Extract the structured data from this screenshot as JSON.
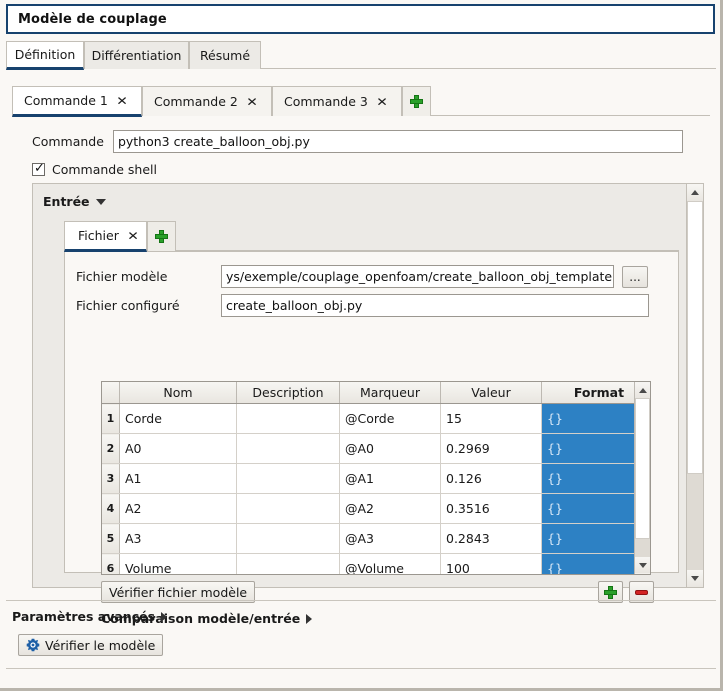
{
  "window": {
    "title": "Modèle de couplage"
  },
  "top_tabs": [
    {
      "label": "Définition",
      "active": true
    },
    {
      "label": "Différentiation",
      "active": false
    },
    {
      "label": "Résumé",
      "active": false
    }
  ],
  "command_tabs": [
    {
      "label": "Commande 1",
      "close_icon": "close-icon",
      "active": true
    },
    {
      "label": "Commande 2",
      "close_icon": "close-icon",
      "active": false
    },
    {
      "label": "Commande 3",
      "close_icon": "close-icon",
      "active": false
    }
  ],
  "command_tabs_add_icon": "plus-icon",
  "command": {
    "label": "Commande",
    "value": "python3 create_balloon_obj.py",
    "placeholder": ""
  },
  "shell": {
    "label": "Commande shell",
    "checked": true,
    "check_glyph": "✓"
  },
  "entree": {
    "label": "Entrée",
    "expander_icon": "triangle-down-icon",
    "file_tabs": [
      {
        "label": "Fichier",
        "close_icon": "close-icon",
        "active": true
      }
    ],
    "file_tabs_add_icon": "plus-icon",
    "fields": [
      {
        "label": "Fichier modèle",
        "value": "ys/exemple/couplage_openfoam/create_balloon_obj_template.py",
        "browse_label": "..."
      },
      {
        "label": "Fichier configuré",
        "value": "create_balloon_obj.py"
      }
    ],
    "table": {
      "columns": [
        "Nom",
        "Description",
        "Marqueur",
        "Valeur",
        "Format"
      ],
      "selected_column": "Format",
      "rows": [
        {
          "num": "1",
          "nom": "Corde",
          "description": "",
          "marqueur": "@Corde",
          "valeur": "15",
          "format": "{}"
        },
        {
          "num": "2",
          "nom": "A0",
          "description": "",
          "marqueur": "@A0",
          "valeur": "0.2969",
          "format": "{}"
        },
        {
          "num": "3",
          "nom": "A1",
          "description": "",
          "marqueur": "@A1",
          "valeur": "0.126",
          "format": "{}"
        },
        {
          "num": "4",
          "nom": "A2",
          "description": "",
          "marqueur": "@A2",
          "valeur": "0.3516",
          "format": "{}"
        },
        {
          "num": "5",
          "nom": "A3",
          "description": "",
          "marqueur": "@A3",
          "valeur": "0.2843",
          "format": "{}"
        },
        {
          "num": "6",
          "nom": "Volume",
          "description": "",
          "marqueur": "@Volume",
          "valeur": "100",
          "format": "{}"
        }
      ]
    },
    "verify_template_button": "Vérifier fichier modèle",
    "add_row_icon": "plus-icon",
    "remove_row_icon": "minus-icon",
    "comparison_label": "Comparaison modèle/entrée",
    "comparison_icon": "triangle-right-icon"
  },
  "advanced": {
    "label": "Paramètres avancés",
    "expander_icon": "triangle-right-icon"
  },
  "verify_model": {
    "label": "Vérifier le modèle",
    "icon": "gear-icon"
  },
  "colors": {
    "title_border": "#17426e",
    "tab_underline": "#17426e",
    "selection": "#2d81c4",
    "panel_bg": "#eceae6",
    "window_bg": "#faf8f5",
    "add_green": "#2aa02a",
    "remove_red": "#d42424"
  }
}
